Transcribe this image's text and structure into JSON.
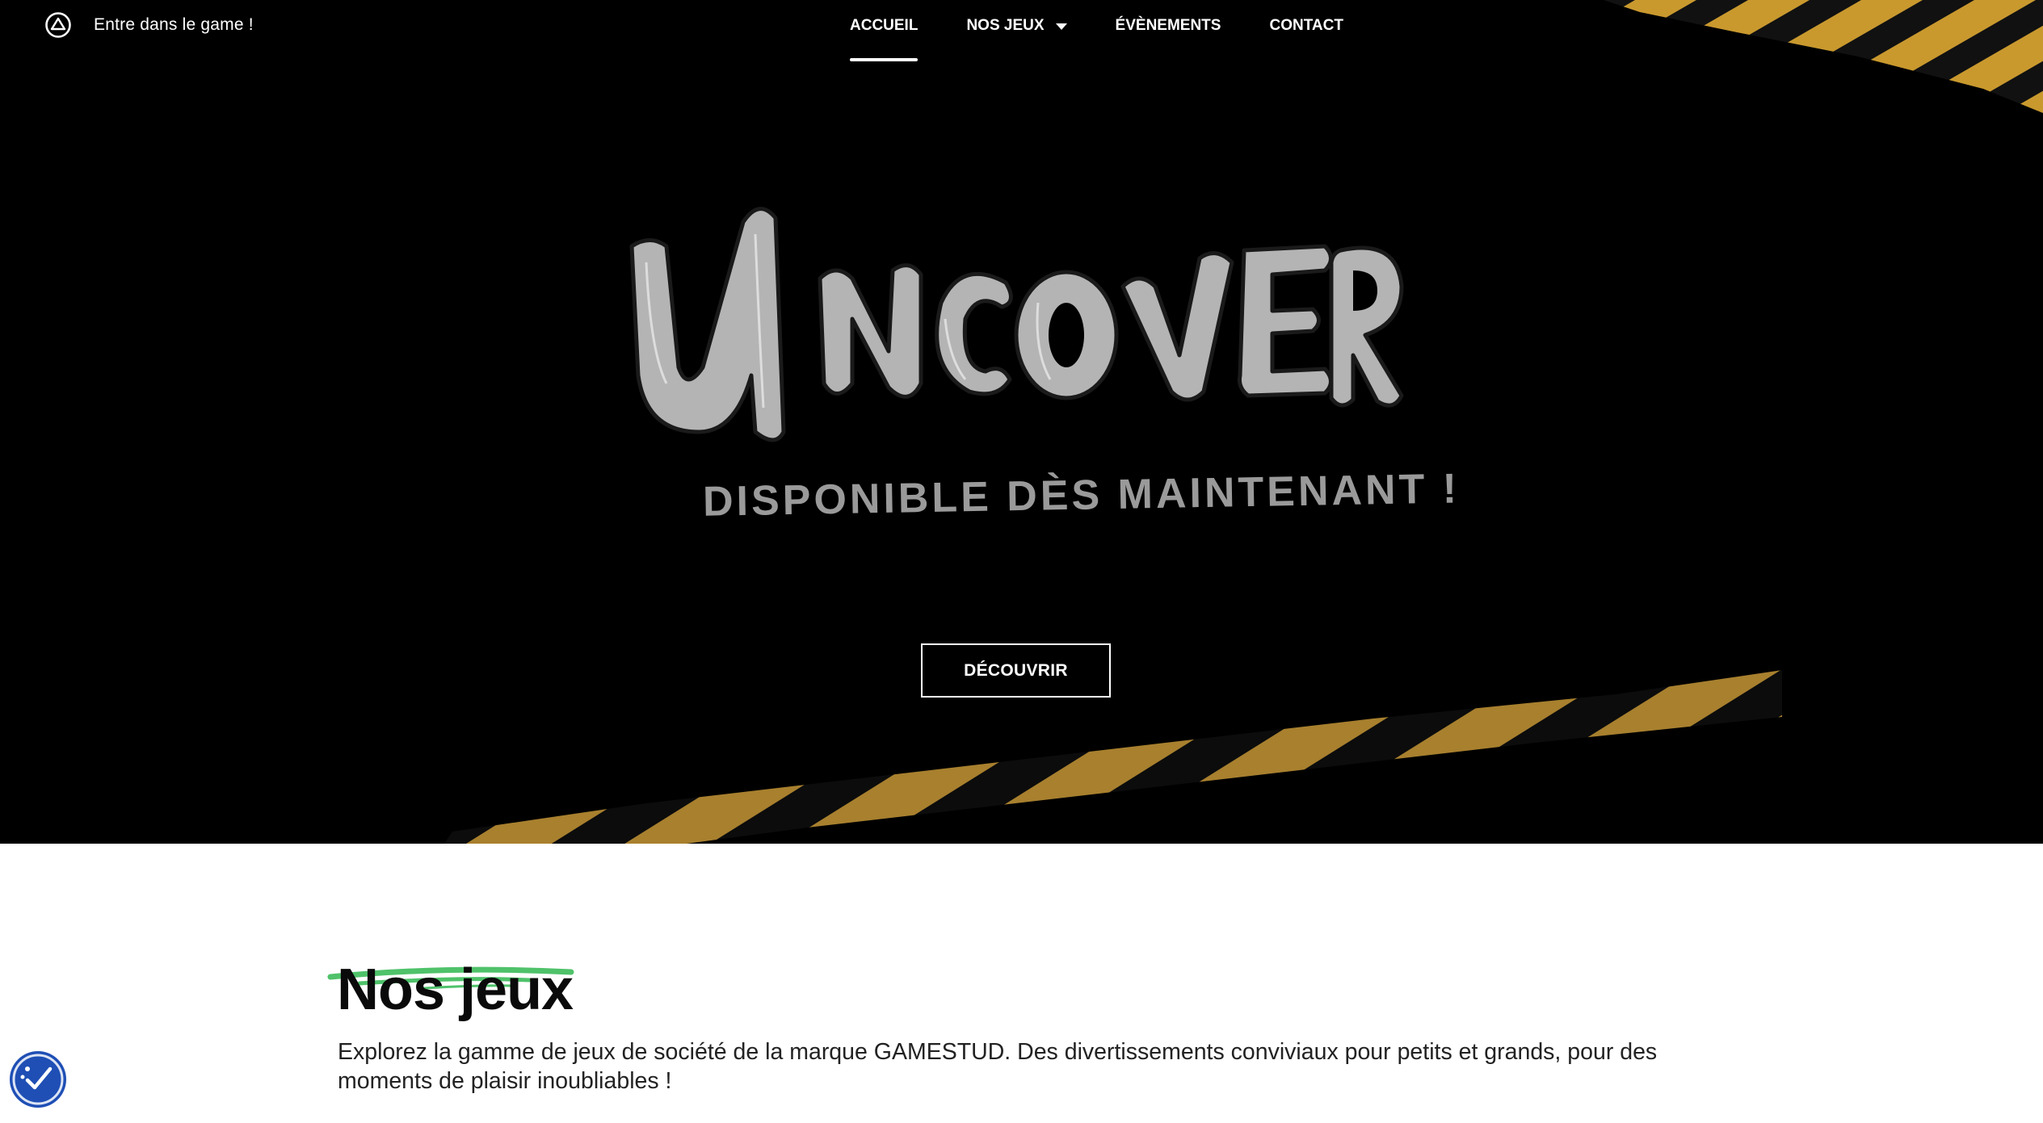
{
  "header": {
    "tagline": "Entre dans le game !",
    "brand_icon": "triangle-circle-icon"
  },
  "nav": {
    "items": [
      {
        "label": "ACCUEIL",
        "active": true
      },
      {
        "label": "NOS JEUX",
        "active": false,
        "has_dropdown": true
      },
      {
        "label": "ÉVÈNEMENTS",
        "active": false
      },
      {
        "label": "CONTACT",
        "active": false
      }
    ]
  },
  "hero": {
    "logo_text": "UNCOVER",
    "subtitle": "DISPONIBLE DÈS MAINTENANT !",
    "cta_label": "DÉCOUVRIR"
  },
  "section": {
    "title": "Nos jeux",
    "description": "Explorez la gamme de jeux de société de la marque GAMESTUD. Des divertissements conviviaux pour petits et grands, pour des moments de plaisir inoubliables !"
  },
  "accessibility": {
    "icon": "accessibility-icon"
  },
  "colors": {
    "hero_background": "#000000",
    "tape_yellow": "#c9992e",
    "underline_green": "#4fc26a",
    "a11y_blue": "#1f4fb5"
  }
}
